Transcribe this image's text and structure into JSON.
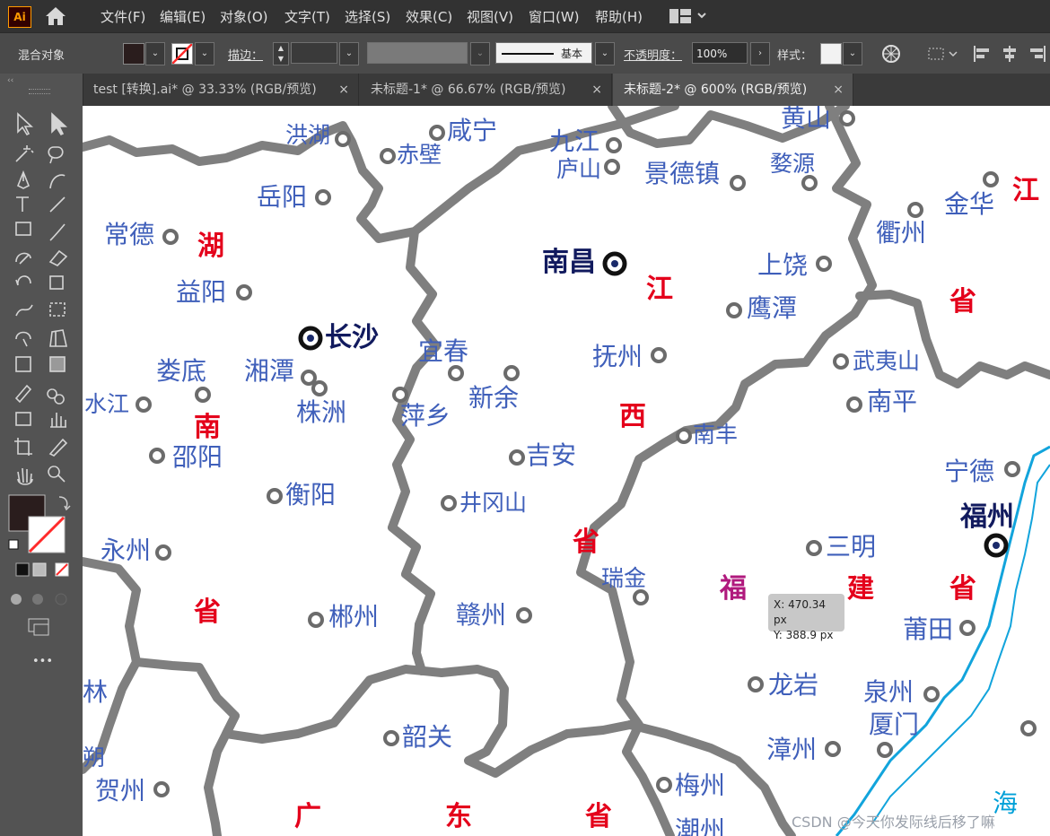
{
  "app": {
    "logo": "Ai"
  },
  "menu": [
    "文件(F)",
    "编辑(E)",
    "对象(O)",
    "文字(T)",
    "选择(S)",
    "效果(C)",
    "视图(V)",
    "窗口(W)",
    "帮助(H)"
  ],
  "control_bar": {
    "mode_label": "混合对象",
    "stroke_label": "描边：",
    "brush_value": "基本",
    "opacity_label": "不透明度：",
    "opacity_value": "100%",
    "style_label": "样式："
  },
  "tabs": [
    {
      "label": "test [转换].ai* @ 33.33% (RGB/预览)",
      "close": "×"
    },
    {
      "label": "未标题-1* @ 66.67% (RGB/预览)",
      "close": "×"
    },
    {
      "label": "未标题-2* @ 600% (RGB/预览)",
      "close": "×",
      "active": true
    }
  ],
  "toolbar": {
    "more": "•••",
    "grip": "‹‹"
  },
  "colors": {
    "fill": "#2a1d1d",
    "stroke_none": "#ff2a2a",
    "city": "#3f5fba",
    "province": "#e4001b",
    "sea_line": "#12a4dc",
    "border": "#7f7f7f"
  },
  "map": {
    "cities": [
      {
        "name": "洪湖"
      },
      {
        "name": "咸宁"
      },
      {
        "name": "赤壁"
      },
      {
        "name": "九江"
      },
      {
        "name": "庐山"
      },
      {
        "name": "景德镇"
      },
      {
        "name": "婺源"
      },
      {
        "name": "黄山"
      },
      {
        "name": "岳阳"
      },
      {
        "name": "常德"
      },
      {
        "name": "金华"
      },
      {
        "name": "衢州"
      },
      {
        "name": "上饶"
      },
      {
        "name": "益阳"
      },
      {
        "name": "鹰潭"
      },
      {
        "name": "宜春"
      },
      {
        "name": "抚州"
      },
      {
        "name": "武夷山"
      },
      {
        "name": "娄底"
      },
      {
        "name": "湘潭"
      },
      {
        "name": "新余"
      },
      {
        "name": "水江"
      },
      {
        "name": "株洲"
      },
      {
        "name": "萍乡"
      },
      {
        "name": "南平"
      },
      {
        "name": "南丰"
      },
      {
        "name": "邵阳"
      },
      {
        "name": "吉安"
      },
      {
        "name": "宁德"
      },
      {
        "name": "衡阳"
      },
      {
        "name": "井冈山"
      },
      {
        "name": "永州"
      },
      {
        "name": "三明"
      },
      {
        "name": "瑞金"
      },
      {
        "name": "郴州"
      },
      {
        "name": "赣州"
      },
      {
        "name": "莆田"
      },
      {
        "name": "龙岩"
      },
      {
        "name": "泉州"
      },
      {
        "name": "厦门"
      },
      {
        "name": "韶关"
      },
      {
        "name": "漳州"
      },
      {
        "name": "贺州"
      },
      {
        "name": "梅州"
      },
      {
        "name": "潮州"
      },
      {
        "name": "林"
      },
      {
        "name": "朔"
      }
    ],
    "capitals": [
      {
        "name": "南昌"
      },
      {
        "name": "长沙"
      },
      {
        "name": "福州"
      }
    ],
    "provinces": [
      "湖",
      "南",
      "省",
      "江",
      "西",
      "省",
      "福",
      "建",
      "省",
      "广",
      "东",
      "省",
      "江",
      "省"
    ],
    "sea": "海"
  },
  "tooltip": {
    "x": "X: 470.34 px",
    "y": "Y: 388.9 px"
  },
  "watermark": "CSDN @今天你发际线后移了嘛"
}
